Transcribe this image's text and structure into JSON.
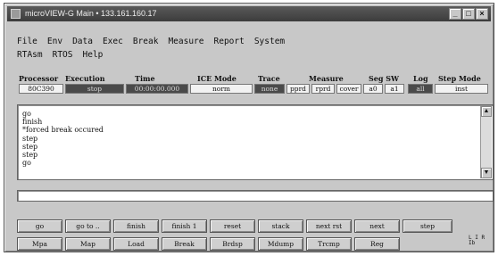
{
  "window": {
    "title": "microVIEW-G Main • 133.161.160.17",
    "controls": {
      "minimize": "_",
      "maximize": "□",
      "close": "×"
    }
  },
  "menu": {
    "row1": [
      "File",
      "Env",
      "Data",
      "Exec",
      "Break",
      "Measure",
      "Report",
      "System"
    ],
    "row2": [
      "RTAsm",
      "RTOS",
      "Help"
    ]
  },
  "status": {
    "headers": [
      "Processor",
      "Execution",
      "Time",
      "ICE Mode",
      "Trace",
      "Measure",
      "Seg SW",
      "Log",
      "Step Mode"
    ],
    "values": [
      {
        "text": "80C390",
        "style": "light"
      },
      {
        "text": "stop",
        "style": "dark"
      },
      {
        "text": "00:00:00.000",
        "style": "dark"
      },
      {
        "text": "norm",
        "style": "light"
      },
      {
        "text": "none",
        "style": "dark"
      },
      {
        "text": "pprd",
        "style": "light"
      },
      {
        "text": "rprd",
        "style": "light"
      },
      {
        "text": "cover",
        "style": "light"
      },
      {
        "text": "a0",
        "style": "light"
      },
      {
        "text": "a1",
        "style": "light"
      },
      {
        "text": "all",
        "style": "dark"
      },
      {
        "text": "inst",
        "style": "light"
      }
    ]
  },
  "output": {
    "lines": [
      "go",
      "finish",
      "*forced break occured",
      "step",
      "step",
      "step",
      "go"
    ]
  },
  "command": {
    "value": ""
  },
  "buttons": {
    "row1": [
      "go",
      "go to ..",
      "finish",
      "finish 1",
      "reset",
      "stack",
      "next rst",
      "next",
      "step"
    ],
    "row2": [
      "Mpa",
      "Map",
      "Load",
      "Break",
      "Brdsp",
      "Mdump",
      "Trcmp",
      "Reg"
    ]
  },
  "corner_icon": {
    "text": "L I R Ib"
  },
  "colors": {
    "window_bg": "#c8c8c8",
    "titlebar": "#3c3c3c",
    "status_dark": "#4a4a4a"
  }
}
